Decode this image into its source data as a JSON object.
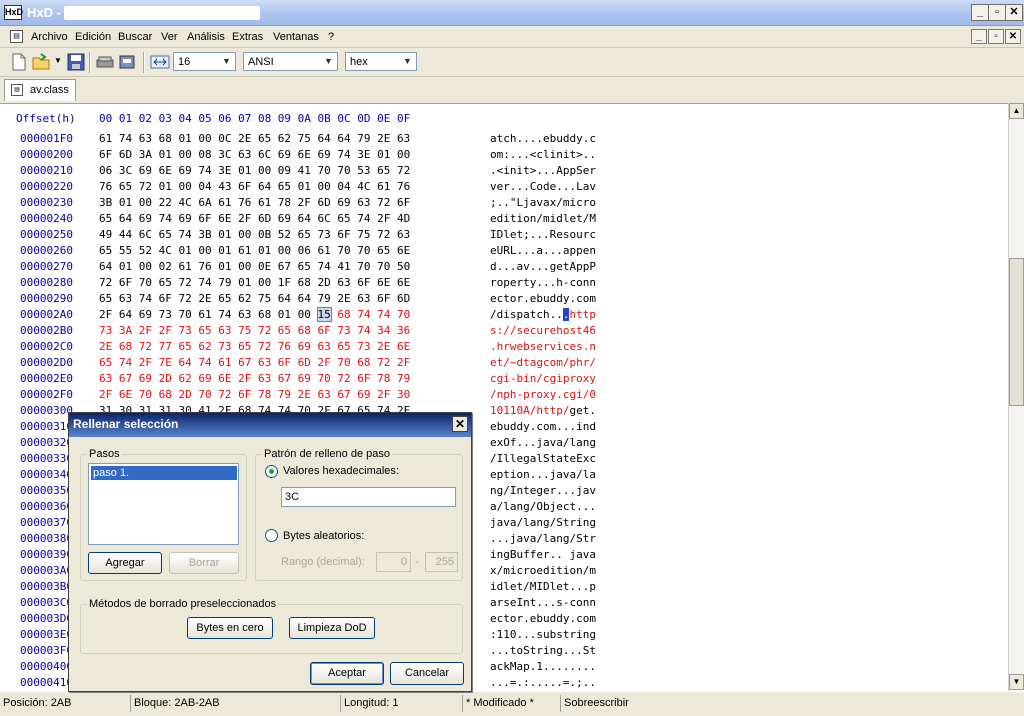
{
  "window": {
    "app_icon": "HxD-icon",
    "title": "HxD - "
  },
  "menu": {
    "items": [
      "Archivo",
      "Edición",
      "Buscar",
      "Ver",
      "Análisis",
      "Extras",
      "Ventanas",
      "?"
    ]
  },
  "toolbar": {
    "bytes_per_row": "16",
    "charset": "ANSI",
    "offset_base": "hex"
  },
  "tabs": [
    {
      "label": "av.class"
    }
  ],
  "hex_editor": {
    "header_offset": "Offset(h)",
    "header_columns": "00 01 02 03 04 05 06 07 08 09 0A 0B 0C 0D 0E 0F",
    "rows": [
      {
        "offset": "000001F0",
        "hex": "61 74 63 68 01 00 0C 2E 65 62 75 64 64 79 2E 63",
        "ascii": "atch....ebuddy.c"
      },
      {
        "offset": "00000200",
        "hex": "6F 6D 3A 01 00 08 3C 63 6C 69 6E 69 74 3E 01 00",
        "ascii": "om:...<clinit>.."
      },
      {
        "offset": "00000210",
        "hex": "06 3C 69 6E 69 74 3E 01 00 09 41 70 70 53 65 72",
        "ascii": ".<init>...AppSer"
      },
      {
        "offset": "00000220",
        "hex": "76 65 72 01 00 04 43 6F 64 65 01 00 04 4C 61 76",
        "ascii": "ver...Code...Lav"
      },
      {
        "offset": "00000230",
        "hex": "3B 01 00 22 4C 6A 61 76 61 78 2F 6D 69 63 72 6F",
        "ascii": ";..\"Ljavax/micro"
      },
      {
        "offset": "00000240",
        "hex": "65 64 69 74 69 6F 6E 2F 6D 69 64 6C 65 74 2F 4D",
        "ascii": "edition/midlet/M"
      },
      {
        "offset": "00000250",
        "hex": "49 44 6C 65 74 3B 01 00 0B 52 65 73 6F 75 72 63",
        "ascii": "IDlet;...Resourc"
      },
      {
        "offset": "00000260",
        "hex": "65 55 52 4C 01 00 01 61 01 00 06 61 70 70 65 6E",
        "ascii": "eURL...a...appen"
      },
      {
        "offset": "00000270",
        "hex": "64 01 00 02 61 76 01 00 0E 67 65 74 41 70 70 50",
        "ascii": "d...av...getAppP"
      },
      {
        "offset": "00000280",
        "hex": "72 6F 70 65 72 74 79 01 00 1F 68 2D 63 6F 6E 6E",
        "ascii": "roperty...h-conn"
      },
      {
        "offset": "00000290",
        "hex": "65 63 74 6F 72 2E 65 62 75 64 64 79 2E 63 6F 6D",
        "ascii": "ector.ebuddy.com"
      },
      {
        "offset": "000002A0",
        "hex_black": "2F 64 69 73 70 61 74 63 68 01 00 ",
        "hex_sel": "15",
        "hex_red": " 68 74 74 70",
        "ascii_black": "/dispatch..",
        "ascii_sel": ".",
        "ascii_red": "http"
      },
      {
        "offset": "000002B0",
        "hex_red": "73 3A 2F 2F 73 65 63 75 72 65 68 6F 73 74 34 36",
        "ascii_red": "s://securehost46"
      },
      {
        "offset": "000002C0",
        "hex_red": "2E 68 72 77 65 62 73 65 72 76 69 63 65 73 2E 6E",
        "ascii_red": ".hrwebservices.n"
      },
      {
        "offset": "000002D0",
        "hex_red": "65 74 2F 7E 64 74 61 67 63 6F 6D 2F 70 68 72 2F",
        "ascii_red": "et/~dtagcom/phr/"
      },
      {
        "offset": "000002E0",
        "hex_red": "63 67 69 2D 62 69 6E 2F 63 67 69 70 72 6F 78 79",
        "ascii_red": "cgi-bin/cgiproxy"
      },
      {
        "offset": "000002F0",
        "hex_red": "2F 6E 70 68 2D 70 72 6F 78 79 2E 63 67 69 2F 30",
        "ascii_red": "/nph-proxy.cgi/0"
      },
      {
        "offset": "00000300",
        "hex": "31 30 31 31 30 41 2F 68 74 74 70 2F 67 65 74 2E",
        "ascii_red": "10110A/http/",
        "ascii_black": "get."
      },
      {
        "offset": "00000310",
        "ascii": "ebuddy.com...ind"
      },
      {
        "offset": "00000320",
        "ascii": "exOf...java/lang"
      },
      {
        "offset": "00000330",
        "ascii": "/IllegalStateExc"
      },
      {
        "offset": "00000340",
        "ascii": "eption...java/la"
      },
      {
        "offset": "00000350",
        "ascii": "ng/Integer...jav"
      },
      {
        "offset": "00000360",
        "ascii": "a/lang/Object..."
      },
      {
        "offset": "00000370",
        "ascii": "java/lang/String"
      },
      {
        "offset": "00000380",
        "ascii": "...java/lang/Str"
      },
      {
        "offset": "00000390",
        "ascii": "ingBuffer.. java"
      },
      {
        "offset": "000003A0",
        "ascii": "x/microedition/m"
      },
      {
        "offset": "000003B0",
        "ascii": "idlet/MIDlet...p"
      },
      {
        "offset": "000003C0",
        "ascii": "arseInt...s-conn"
      },
      {
        "offset": "000003D0",
        "ascii": "ector.ebuddy.com"
      },
      {
        "offset": "000003E0",
        "ascii": ":110...substring"
      },
      {
        "offset": "000003F0",
        "ascii": "...toString...St"
      },
      {
        "offset": "00000400",
        "ascii": "ackMap.1........"
      },
      {
        "offset": "00000410",
        "ascii": "...=.:.....=.;.."
      }
    ]
  },
  "dialog": {
    "title": "Rellenar selección",
    "steps_group": "Pasos",
    "steps": [
      "paso 1."
    ],
    "add_button": "Agregar",
    "delete_button": "Borrar",
    "pattern_group": "Patrón de relleno de paso",
    "hex_radio": "Valores hexadecimales:",
    "hex_value": "3C",
    "random_radio": "Bytes aleatorios:",
    "range_label": "Rango (decimal):",
    "range_min": "0",
    "range_sep": "-",
    "range_max": "255",
    "presets_group": "Métodos de borrado preseleccionados",
    "zero_button": "Bytes en cero",
    "dod_button": "Limpieza DoD",
    "ok_button": "Aceptar",
    "cancel_button": "Cancelar"
  },
  "status": {
    "position": "Posición: 2AB",
    "block": "Bloque: 2AB-2AB",
    "length": "Longitud: 1",
    "modified": "* Modificado *",
    "overwrite": "Sobreescribir"
  },
  "colors": {
    "highlight_red": "#d11111",
    "offset_blue": "#0000aa",
    "dialog_title": "#0a246a"
  }
}
